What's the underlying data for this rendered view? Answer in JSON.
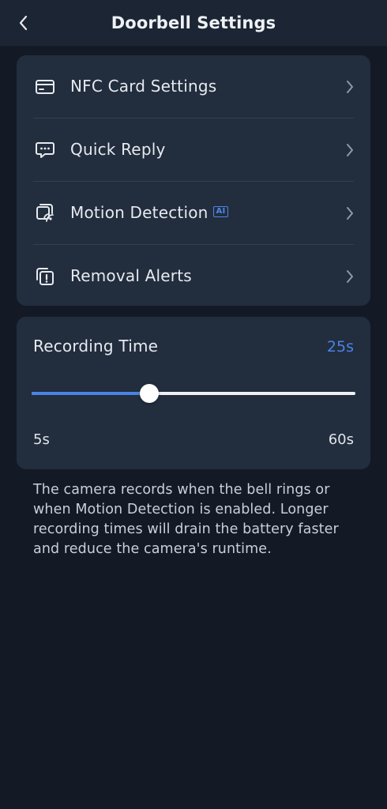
{
  "header": {
    "title": "Doorbell Settings"
  },
  "menu": {
    "items": [
      {
        "label": "NFC Card Settings",
        "icon": "card-icon"
      },
      {
        "label": "Quick Reply",
        "icon": "chat-bubble-icon"
      },
      {
        "label": "Motion Detection",
        "icon": "motion-screen-icon",
        "badge": "AI"
      },
      {
        "label": "Removal Alerts",
        "icon": "alert-copy-icon"
      }
    ]
  },
  "recording": {
    "title": "Recording Time",
    "value_label": "25s",
    "value": 25,
    "min": 5,
    "max": 60,
    "min_label": "5s",
    "max_label": "60s"
  },
  "description": "The camera records when the bell rings or when Motion Detection is enabled. Longer recording times will drain the battery faster and reduce the camera's runtime.",
  "colors": {
    "background": "#131a26",
    "card": "#222d3d",
    "accent": "#4b82e6"
  }
}
